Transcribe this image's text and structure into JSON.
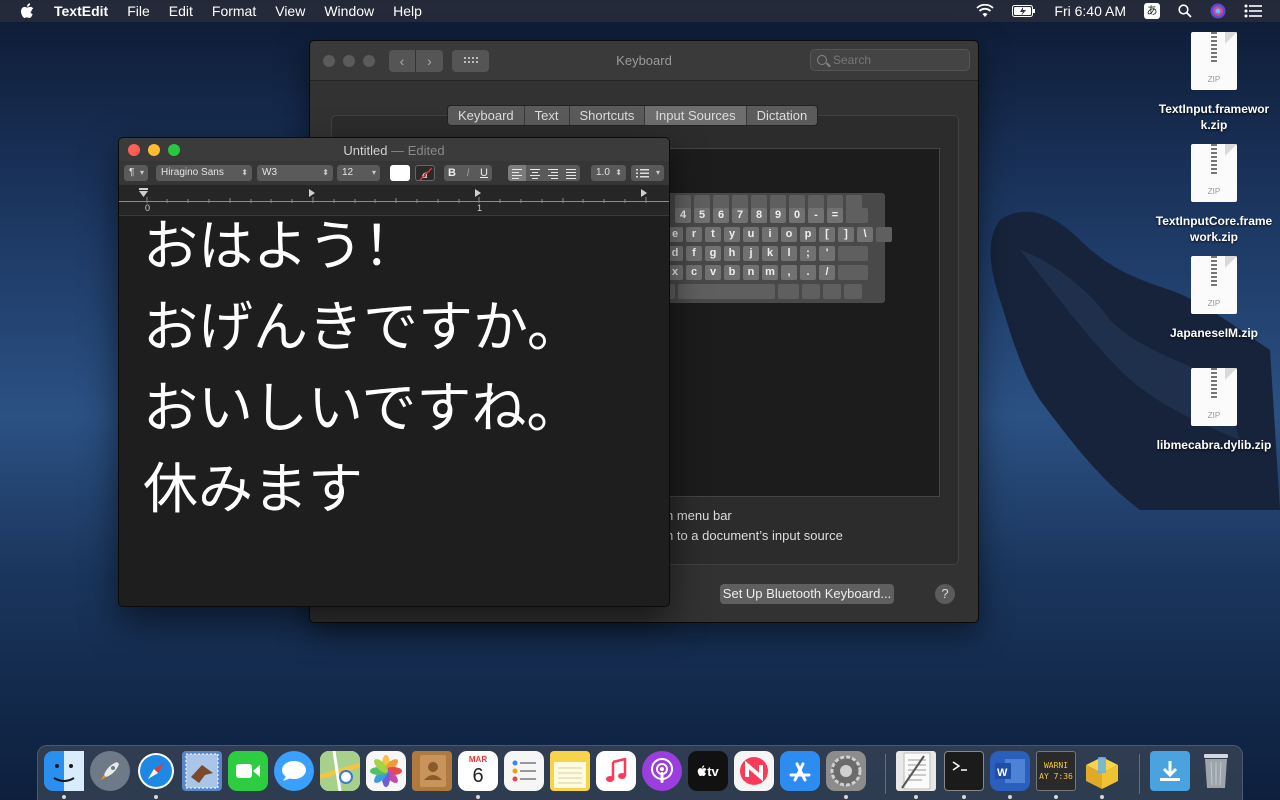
{
  "menubar": {
    "app": "TextEdit",
    "menus": [
      "File",
      "Edit",
      "Format",
      "View",
      "Window",
      "Help"
    ],
    "clock": "Fri 6:40 AM",
    "input_indicator": "あ"
  },
  "prefs": {
    "title": "Keyboard",
    "search_placeholder": "Search",
    "tabs": [
      "Keyboard",
      "Text",
      "Shortcuts",
      "Input Sources",
      "Dictation"
    ],
    "selected_tab": "Input Sources",
    "option_menu_bar": "n menu bar",
    "option_switch": "h to a document’s input source",
    "bluetooth_button": "Set Up Bluetooth Keyboard...",
    "help": "?",
    "keyboard_rows": [
      [
        "4",
        "5",
        "6",
        "7",
        "8",
        "9",
        "0",
        "-",
        "="
      ],
      [
        "e",
        "r",
        "t",
        "y",
        "u",
        "i",
        "o",
        "p",
        "[",
        "]",
        "\\"
      ],
      [
        "d",
        "f",
        "g",
        "h",
        "j",
        "k",
        "l",
        ";",
        "'"
      ],
      [
        "x",
        "c",
        "v",
        "b",
        "n",
        "m",
        ",",
        ".",
        "/"
      ]
    ]
  },
  "textedit": {
    "title": "Untitled",
    "separator": "—",
    "status": "Edited",
    "toolbar": {
      "paragraph": "¶",
      "font_family": "Hiragino Sans",
      "font_weight": "W3",
      "font_size": "12",
      "bold": "B",
      "italic": "I",
      "underline": "U",
      "line_spacing": "1.0"
    },
    "ruler": {
      "mark0": "0",
      "mark1": "1"
    },
    "lines": [
      "おはよう！",
      "おげんきですか。",
      "おいしいですね。",
      "休みます"
    ]
  },
  "desktop_icons": [
    {
      "label": "TextInput.framework.zip",
      "badge": "ZIP"
    },
    {
      "label": "TextInputCore.framework.zip",
      "badge": "ZIP"
    },
    {
      "label": "JapaneseIM.zip",
      "badge": "ZIP"
    },
    {
      "label": "libmecabra.dylib.zip",
      "badge": "ZIP"
    }
  ],
  "dock": {
    "calendar_month": "MAR",
    "calendar_day": "6",
    "tv_label": "tv",
    "console_label": "WARNI",
    "console_time": "AY 7:36",
    "items": [
      {
        "name": "finder",
        "color": "#2b8ff0"
      },
      {
        "name": "launchpad",
        "color": "#6f7a88"
      },
      {
        "name": "safari",
        "color": "#1e88e5"
      },
      {
        "name": "mail",
        "color": "#5b87c9"
      },
      {
        "name": "facetime",
        "color": "#2ecc40"
      },
      {
        "name": "messages",
        "color": "#3aa0ff"
      },
      {
        "name": "maps",
        "color": "#56b36a"
      },
      {
        "name": "photos",
        "color": "#f4f4f4"
      },
      {
        "name": "contacts",
        "color": "#b07a3f"
      },
      {
        "name": "calendar",
        "color": "#ffffff"
      },
      {
        "name": "reminders",
        "color": "#f6f6f6"
      },
      {
        "name": "notes",
        "color": "#f7d44a"
      },
      {
        "name": "music",
        "color": "#fb3a5a"
      },
      {
        "name": "podcasts",
        "color": "#9b3ede"
      },
      {
        "name": "tv",
        "color": "#111111"
      },
      {
        "name": "news",
        "color": "#f5f5f5"
      },
      {
        "name": "app-store",
        "color": "#2d8cf0"
      },
      {
        "name": "system-preferences",
        "color": "#8c8c8c"
      },
      {
        "name": "textedit",
        "color": "#e8e8e8"
      },
      {
        "name": "terminal",
        "color": "#1b1b1b"
      },
      {
        "name": "word",
        "color": "#2b5fbd"
      },
      {
        "name": "console",
        "color": "#2a2a2a"
      },
      {
        "name": "archive-utility",
        "color": "#f0c330"
      },
      {
        "name": "downloads",
        "color": "#4aa3df"
      },
      {
        "name": "trash",
        "color": "#9ea4ab"
      }
    ]
  }
}
